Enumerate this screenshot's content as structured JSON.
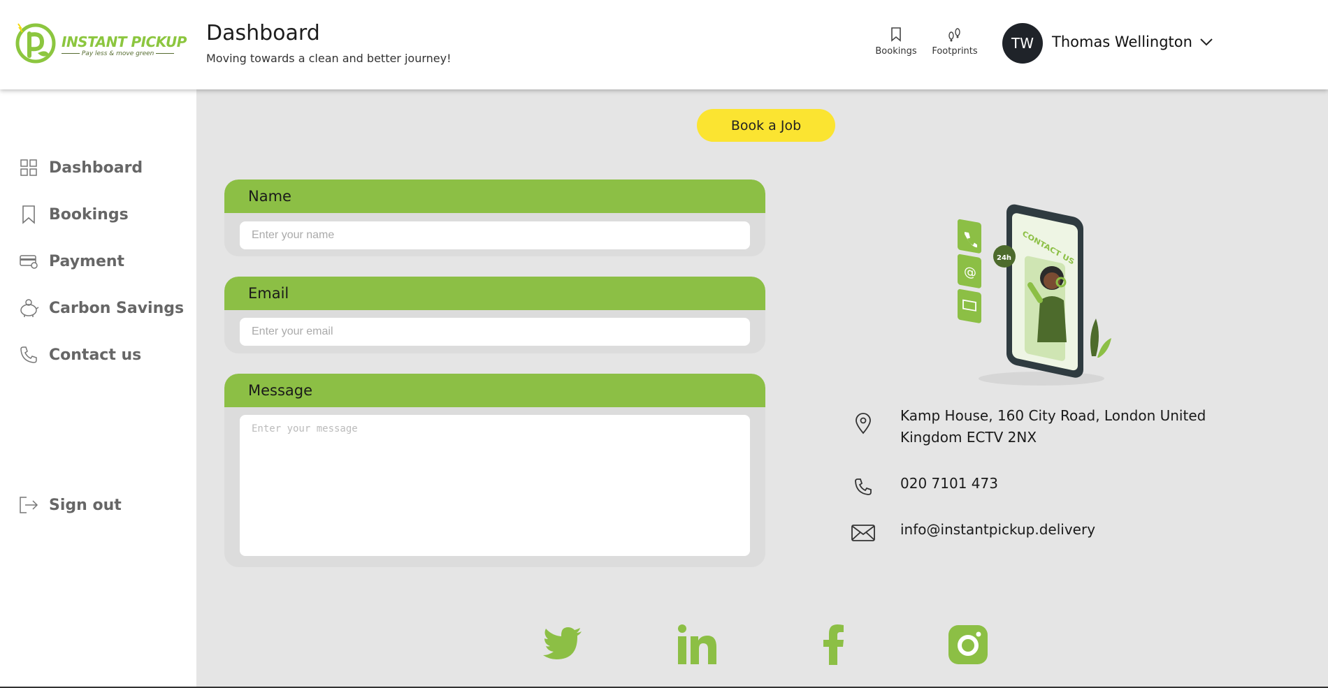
{
  "brand": {
    "name": "INSTANT PICKUP",
    "tagline": "Pay less & move green"
  },
  "header": {
    "title": "Dashboard",
    "subtitle": "Moving towards a clean and better journey!",
    "links": {
      "bookings": "Bookings",
      "footprints": "Footprints"
    },
    "user": {
      "initials": "TW",
      "name": "Thomas Wellington"
    }
  },
  "sidebar": {
    "items": [
      {
        "label": "Dashboard",
        "icon": "grid-icon"
      },
      {
        "label": "Bookings",
        "icon": "bookmark-icon"
      },
      {
        "label": "Payment",
        "icon": "card-icon"
      },
      {
        "label": "Carbon Savings",
        "icon": "piggy-bank-icon"
      },
      {
        "label": "Contact us",
        "icon": "phone-icon"
      }
    ],
    "sign_out": "Sign out"
  },
  "main": {
    "book_button": "Book a Job",
    "form": {
      "name_label": "Name",
      "name_placeholder": "Enter your name",
      "email_label": "Email",
      "email_placeholder": "Enter your email",
      "message_label": "Message",
      "message_placeholder": "Enter your message"
    },
    "illustration": {
      "screen_text": "CONTACT US",
      "badge": "24h"
    },
    "contact": {
      "address": "Kamp House, 160 City Road, London United Kingdom ECTV 2NX",
      "phone": "020 7101 473",
      "email": "info@instantpickup.delivery"
    },
    "social": [
      "twitter-icon",
      "linkedin-icon",
      "facebook-icon",
      "instagram-icon"
    ]
  },
  "colors": {
    "accent_green": "#8cbf45",
    "button_yellow": "#fbe431",
    "avatar_bg": "#1f2329"
  }
}
